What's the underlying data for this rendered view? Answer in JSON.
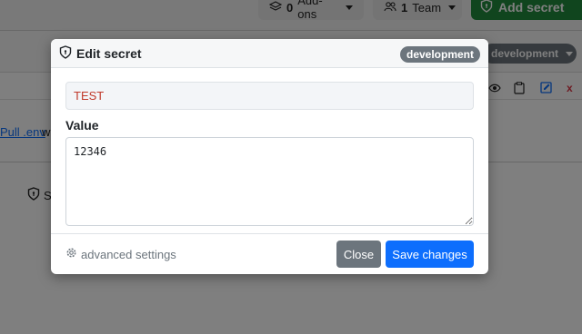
{
  "background": {
    "topbar": {
      "addons": {
        "count": "0",
        "label": "Add-ons"
      },
      "team": {
        "count": "1",
        "label": "Team"
      },
      "add_secret_label": "Add secret"
    },
    "env_badge": "development",
    "pull_link": "Pull .env",
    "pull_rest": "w",
    "shield_text": "S"
  },
  "modal": {
    "title": "Edit secret",
    "environment": "development",
    "key_value": "TEST",
    "value_label": "Value",
    "value_text": "12346",
    "advanced_label": "advanced settings",
    "close_label": "Close",
    "save_label": "Save changes"
  },
  "colors": {
    "primary": "#0d6efd",
    "secondary": "#6c757d",
    "success": "#218a3c",
    "key_text": "#c0392b"
  }
}
